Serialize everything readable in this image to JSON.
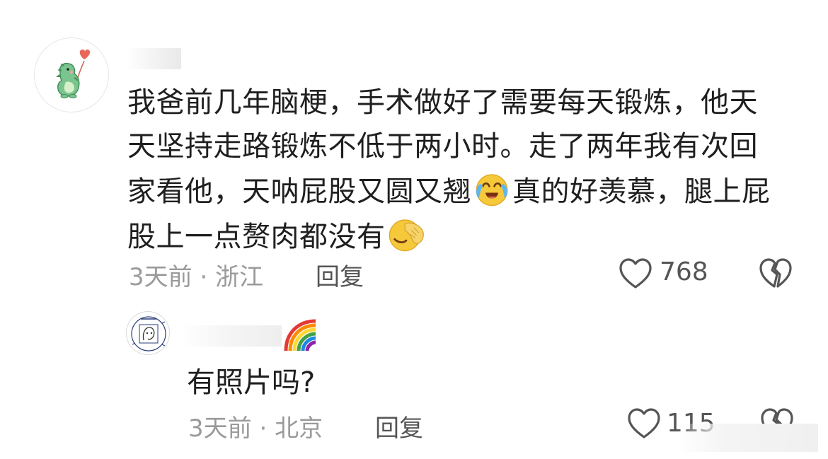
{
  "main_comment": {
    "avatar_icon": "dinosaur-with-heart-balloon",
    "text_part1": "我爸前几年脑梗，手术做好了需要每天锻炼，他天天坚持走路锻炼不低于两小时。走了两年我有次回家看他，天呐屁股又圆又翘",
    "emoji1": "crying-laughing-emoji",
    "text_part2": "真的好羡慕，腿上屁股上一点赘肉都没有",
    "emoji2": "facepalm-emoji",
    "time": "3天前",
    "separator": "·",
    "location": "浙江",
    "reply_label": "回复",
    "like_count": "768"
  },
  "reply_comment": {
    "avatar_icon": "sketch-portrait-avatar",
    "name_badge": "rainbow-emoji",
    "text": "有照片吗?",
    "time": "3天前",
    "separator": "·",
    "location": "北京",
    "reply_label": "回复",
    "like_count": "115"
  },
  "colors": {
    "text": "#1f1f1f",
    "meta": "#9a9a9a",
    "action": "#555555",
    "background": "#ffffff"
  }
}
